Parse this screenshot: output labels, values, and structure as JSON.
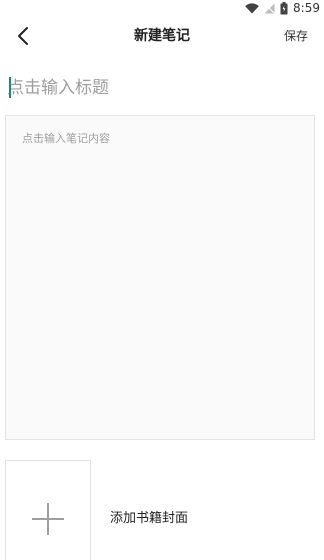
{
  "status_bar": {
    "time": "8:59",
    "icons": [
      "wifi-icon",
      "signal-icon",
      "battery-icon"
    ]
  },
  "app_bar": {
    "back_icon": "chevron-left-icon",
    "title": "新建笔记",
    "save_label": "保存"
  },
  "note": {
    "title_placeholder": "点击输入标题",
    "title_value": "",
    "content_placeholder": "点击输入笔记内容",
    "content_value": ""
  },
  "cover": {
    "add_icon": "plus-icon",
    "label": "添加书籍封面"
  },
  "colors": {
    "accent": "#1b8a78",
    "placeholder": "#9e9e9e",
    "border": "#e3e3e3",
    "content_bg": "#fafafa"
  }
}
